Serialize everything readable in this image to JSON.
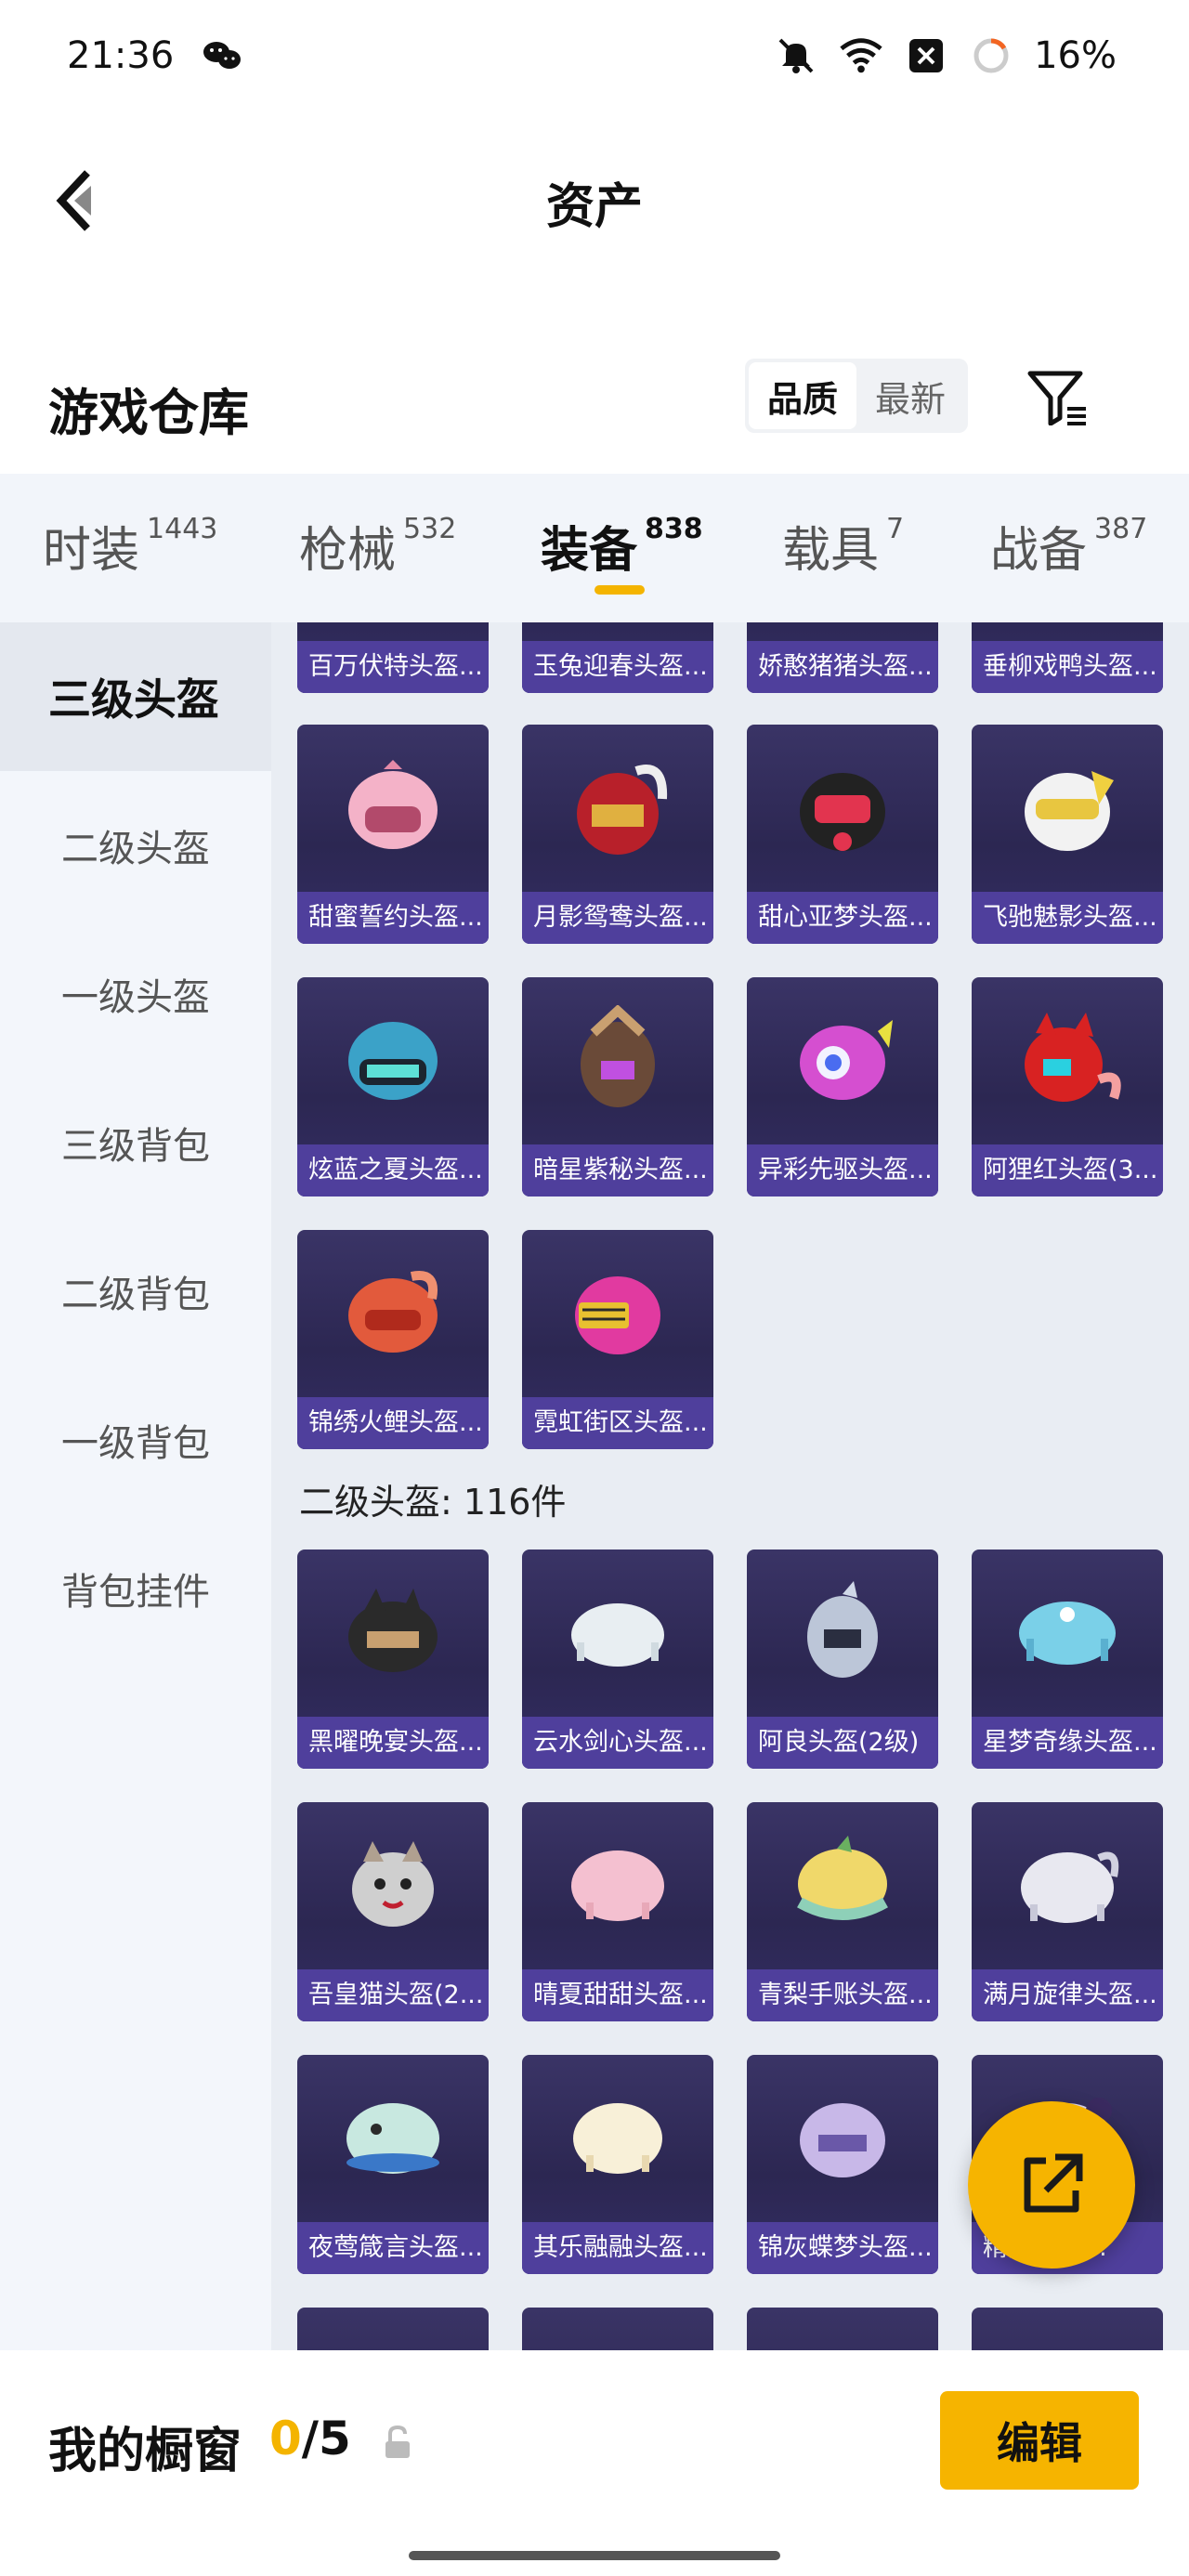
{
  "status_bar": {
    "time": "21:36",
    "battery": "16%"
  },
  "header": {
    "title": "资产"
  },
  "section": {
    "title": "游戏仓库",
    "sort_options": [
      "品质",
      "最新"
    ]
  },
  "tabs": [
    {
      "label": "时装",
      "count": "1443"
    },
    {
      "label": "枪械",
      "count": "532"
    },
    {
      "label": "装备",
      "count": "838",
      "active": true
    },
    {
      "label": "载具",
      "count": "7"
    },
    {
      "label": "战备",
      "count": "387"
    }
  ],
  "sidebar": {
    "items": [
      "三级头盔",
      "二级头盔",
      "一级头盔",
      "三级背包",
      "二级背包",
      "一级背包",
      "背包挂件"
    ]
  },
  "groups": {
    "level3_partial": [
      "百万伏特头盔...",
      "玉兔迎春头盔...",
      "娇憨猪猪头盔...",
      "垂柳戏鸭头盔..."
    ],
    "level3": [
      "甜蜜誓约头盔...",
      "月影鸳鸯头盔...",
      "甜心亚梦头盔...",
      "飞驰魅影头盔...",
      "炫蓝之夏头盔...",
      "暗星紫秘头盔...",
      "异彩先驱头盔...",
      "阿狸红头盔(3...",
      "锦绣火鲤头盔...",
      "霓虹街区头盔..."
    ],
    "level2_title": "二级头盔: 116件",
    "level2": [
      "黑曜晚宴头盔...",
      "云水剑心头盔...",
      "阿良头盔(2级)",
      "星梦奇缘头盔...",
      "吾皇猫头盔(2...",
      "晴夏甜甜头盔...",
      "青梨手账头盔...",
      "满月旋律头盔...",
      "夜莺箴言头盔...",
      "其乐融融头盔...",
      "锦灰蝶梦头盔...",
      "精灵头盔..."
    ]
  },
  "bottom": {
    "title": "我的橱窗",
    "current": "0",
    "total": "/5",
    "edit_label": "编辑"
  },
  "colors": {
    "accent": "#f6b400",
    "card_label": "#4f3f9c",
    "card_bg": "#2c2752"
  }
}
